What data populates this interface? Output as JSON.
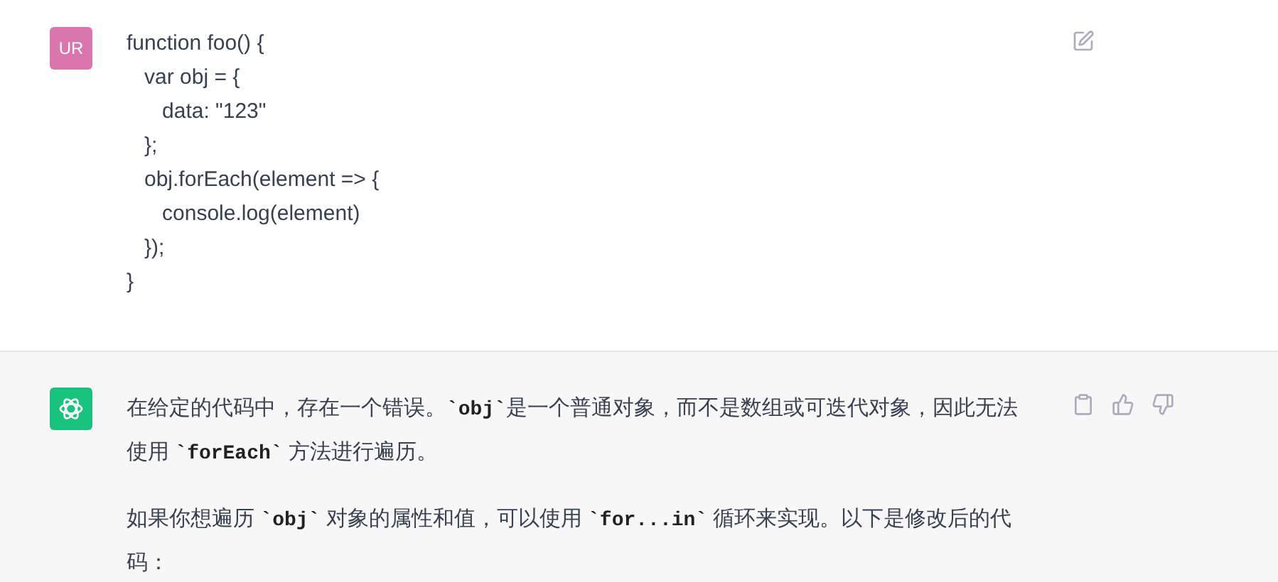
{
  "messages": [
    {
      "kind": "user",
      "avatar": "UR",
      "lines": [
        "function foo() {",
        "   var obj = {",
        "      data: \"123\"",
        "   };",
        "   obj.forEach(element => {",
        "      console.log(element)",
        "   });",
        "}"
      ]
    },
    {
      "kind": "assistant",
      "paragraphs": [
        [
          {
            "kind": "text",
            "text": "在给定的代码中，存在一个错误。"
          },
          {
            "kind": "code",
            "text": "`obj`"
          },
          {
            "kind": "text",
            "text": "是一个普通对象，而不是数组或可迭代对象，因此无法使用 "
          },
          {
            "kind": "code",
            "text": "`forEach`"
          },
          {
            "kind": "text",
            "text": " 方法进行遍历。"
          }
        ],
        [
          {
            "kind": "text",
            "text": "如果你想遍历 "
          },
          {
            "kind": "code",
            "text": "`obj`"
          },
          {
            "kind": "text",
            "text": " 对象的属性和值，可以使用 "
          },
          {
            "kind": "code",
            "text": "`for...in`"
          },
          {
            "kind": "text",
            "text": " 循环来实现。以下是修改后的代码："
          }
        ]
      ]
    }
  ]
}
